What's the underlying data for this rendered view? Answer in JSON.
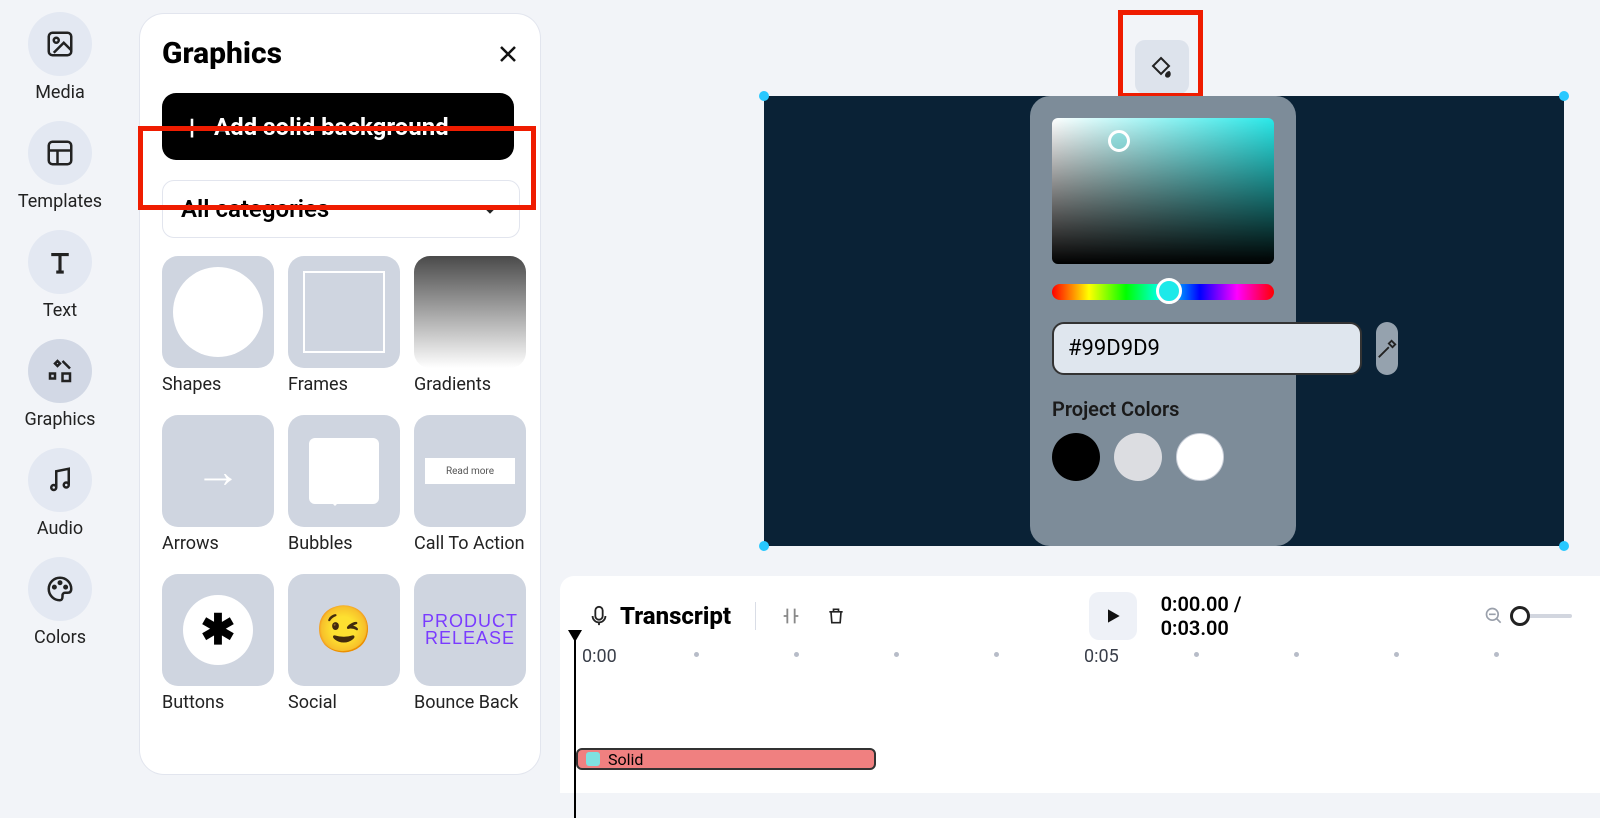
{
  "sidebar": {
    "items": [
      {
        "label": "Media"
      },
      {
        "label": "Templates"
      },
      {
        "label": "Text"
      },
      {
        "label": "Graphics"
      },
      {
        "label": "Audio"
      },
      {
        "label": "Colors"
      }
    ]
  },
  "panel": {
    "title": "Graphics",
    "add_bg_label": "Add solid background",
    "categories_label": "All categories",
    "cards": [
      {
        "label": "Shapes"
      },
      {
        "label": "Frames"
      },
      {
        "label": "Gradients"
      },
      {
        "label": "Arrows"
      },
      {
        "label": "Bubbles"
      },
      {
        "label": "Call To Action"
      },
      {
        "label": "Buttons"
      },
      {
        "label": "Social"
      },
      {
        "label": "Bounce Back"
      }
    ],
    "cta_thumb_text": "Read more",
    "bounce_thumb_text": "PRODUCT RELEASE"
  },
  "color_picker": {
    "hex": "#99D9D9",
    "project_colors_title": "Project Colors",
    "swatches": [
      "#000000",
      "#dcdde1",
      "#ffffff"
    ]
  },
  "timeline": {
    "transcript_label": "Transcript",
    "time_current": "0:00.00",
    "time_total": "0:03.00",
    "ruler": {
      "labels": [
        "0:00",
        "0:05"
      ]
    },
    "clip_label": "Solid"
  }
}
